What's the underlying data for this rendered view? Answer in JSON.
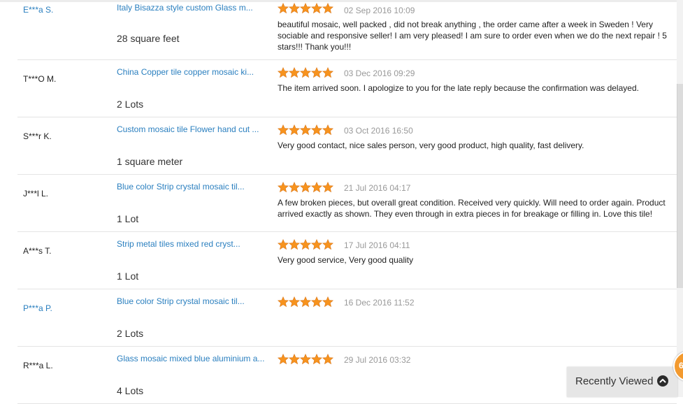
{
  "reviews": [
    {
      "buyer": "E***a S.",
      "product": "Italy Bisazza style custom Glass m...",
      "quantity": "28 square feet",
      "rating": 5,
      "date": "02 Sep 2016 10:09",
      "feedback": "beautiful mosaic, well packed , did not break anything , the order came after a week in Sweden ! Very sociable and responsive seller! I am very pleased! I am sure to order even when we do the next repair ! 5 stars!!! Thank you!!!"
    },
    {
      "buyer": "T***O M.",
      "product": "China Copper tile copper mosaic ki...",
      "quantity": "2 Lots",
      "rating": 5,
      "date": "03 Dec 2016 09:29",
      "feedback": "The item arrived soon. I apologize to you for the late reply because the confirmation was delayed."
    },
    {
      "buyer": "S***r K.",
      "product": "Custom mosaic tile Flower hand cut ...",
      "quantity": "1 square meter",
      "rating": 5,
      "date": "03 Oct 2016 16:50",
      "feedback": "Very good contact, nice sales person, very good product, high quality, fast delivery."
    },
    {
      "buyer": "J***l L.",
      "product": "Blue color Strip crystal mosaic til...",
      "quantity": "1 Lot",
      "rating": 5,
      "date": "21 Jul 2016 04:17",
      "feedback": "A few broken pieces, but overall great condition. Received very quickly. Will need to order again. Product arrived exactly as shown. They even through in extra pieces in for breakage or filling in. Love this tile!"
    },
    {
      "buyer": "A***s T.",
      "product": "Strip metal tiles mixed red cryst...",
      "quantity": "1 Lot",
      "rating": 5,
      "date": "17 Jul 2016 04:11",
      "feedback": "Very good service, Very good quality"
    },
    {
      "buyer": "P***a P.",
      "product": "Blue color Strip crystal mosaic til...",
      "quantity": "2 Lots",
      "rating": 5,
      "date": "16 Dec 2016 11:52",
      "feedback": ""
    },
    {
      "buyer": "R***a L.",
      "product": "Glass mosaic mixed blue aluminium a...",
      "quantity": "4 Lots",
      "rating": 5,
      "date": "29 Jul 2016 03:32",
      "feedback": ""
    }
  ],
  "buyer_link_rows": [
    0,
    5
  ],
  "recently_viewed": {
    "label": "Recently Viewed",
    "badge": "6",
    "icon": "chevron-up-icon"
  },
  "colors": {
    "link": "#2a7fbf",
    "star": "#f7931e",
    "date": "#999999",
    "badge": "#f39a2f"
  }
}
